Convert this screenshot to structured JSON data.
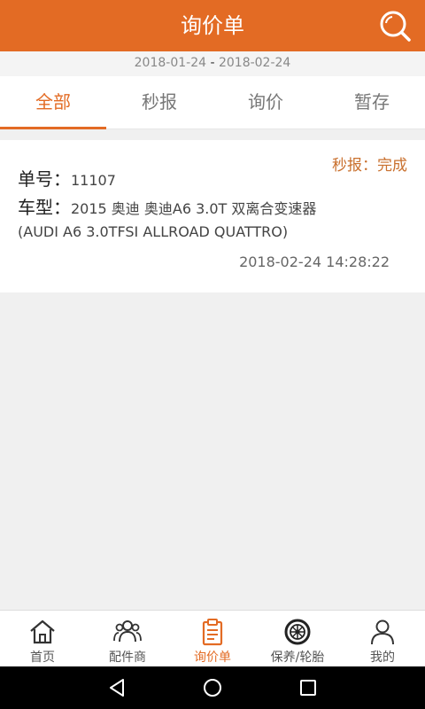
{
  "header": {
    "title": "询价单"
  },
  "date_range": {
    "start": "2018-01-24",
    "separator": " - ",
    "end": "2018-02-24"
  },
  "tabs": [
    {
      "label": "全部",
      "active": true
    },
    {
      "label": "秒报",
      "active": false
    },
    {
      "label": "询价",
      "active": false
    },
    {
      "label": "暂存",
      "active": false
    }
  ],
  "order": {
    "status": "秒报：完成",
    "number_label": "单号：",
    "number": "11107",
    "model_label": "车型：",
    "model": "2015 奥迪 奥迪A6 3.0T 双离合变速器",
    "model_detail": "(AUDI A6 3.0TFSI ALLROAD QUATTRO)",
    "time": "2018-02-24 14:28:22"
  },
  "bottom_nav": [
    {
      "label": "首页",
      "icon": "home-icon"
    },
    {
      "label": "配件商",
      "icon": "users-icon"
    },
    {
      "label": "询价单",
      "icon": "clipboard-icon",
      "active": true
    },
    {
      "label": "保养/轮胎",
      "icon": "tire-icon"
    },
    {
      "label": "我的",
      "icon": "user-icon"
    }
  ],
  "colors": {
    "accent": "#e36b24",
    "status": "#c9702e"
  }
}
